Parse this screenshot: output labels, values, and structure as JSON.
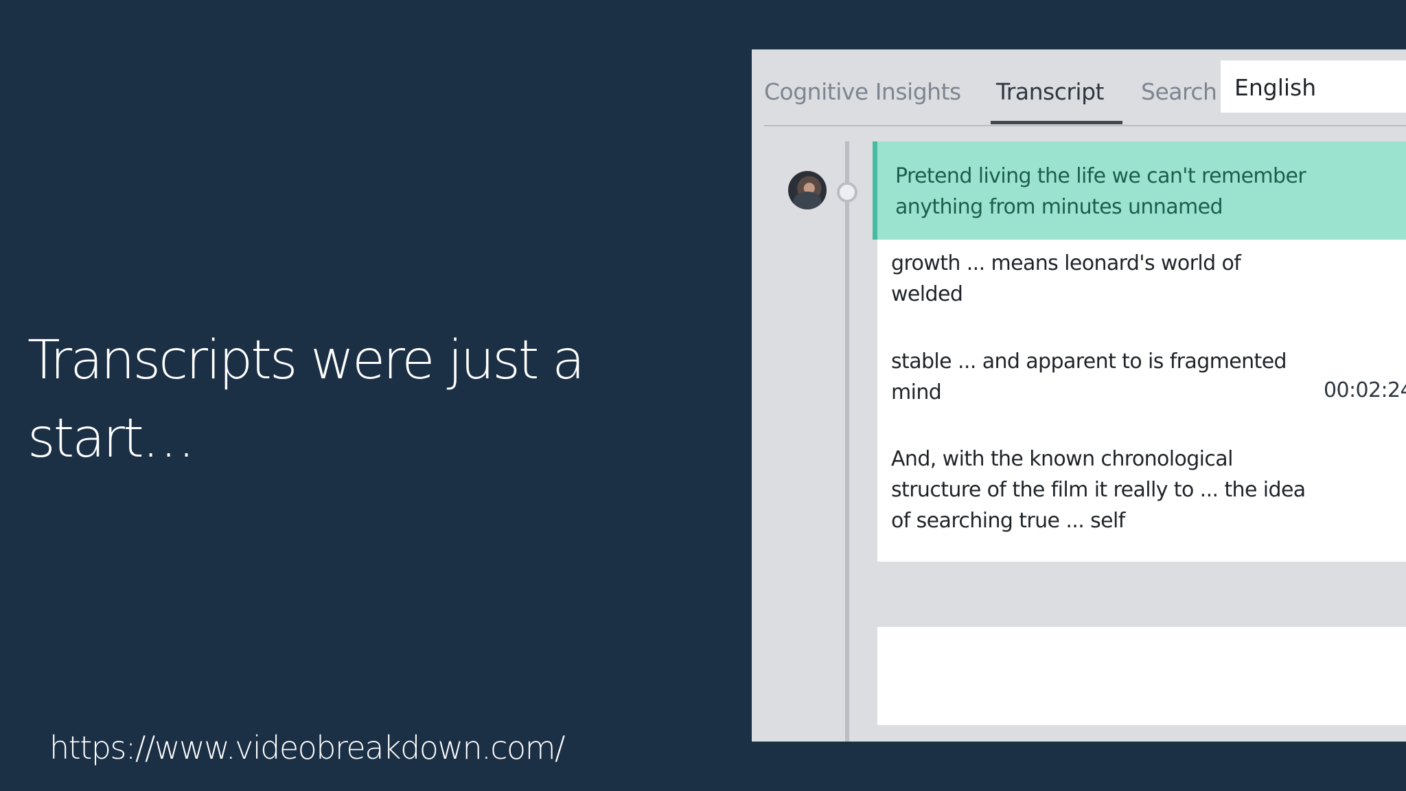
{
  "slide": {
    "headline_line1": "Transcripts were just a",
    "headline_line2": "start…",
    "url": "https://www.videobreakdown.com/"
  },
  "panel": {
    "tabs": [
      {
        "label": "Cognitive Insights",
        "active": false
      },
      {
        "label": "Transcript",
        "active": true
      },
      {
        "label": "Search",
        "active": false
      }
    ],
    "language_select": {
      "value": "English"
    },
    "transcript": {
      "highlighted_line": "Pretend living the life we can't remember anything from minutes unnamed",
      "lines": [
        "growth ... means leonard's world of welded",
        "stable ... and apparent to is fragmented mind",
        "And, with the known chronological structure of the film it really to ... the idea of searching true ... self"
      ],
      "timestamp": "00:02:24"
    }
  },
  "colors": {
    "background": "#1b2f45",
    "highlight": "#9be3cf",
    "highlight_text": "#1d5c4f"
  }
}
